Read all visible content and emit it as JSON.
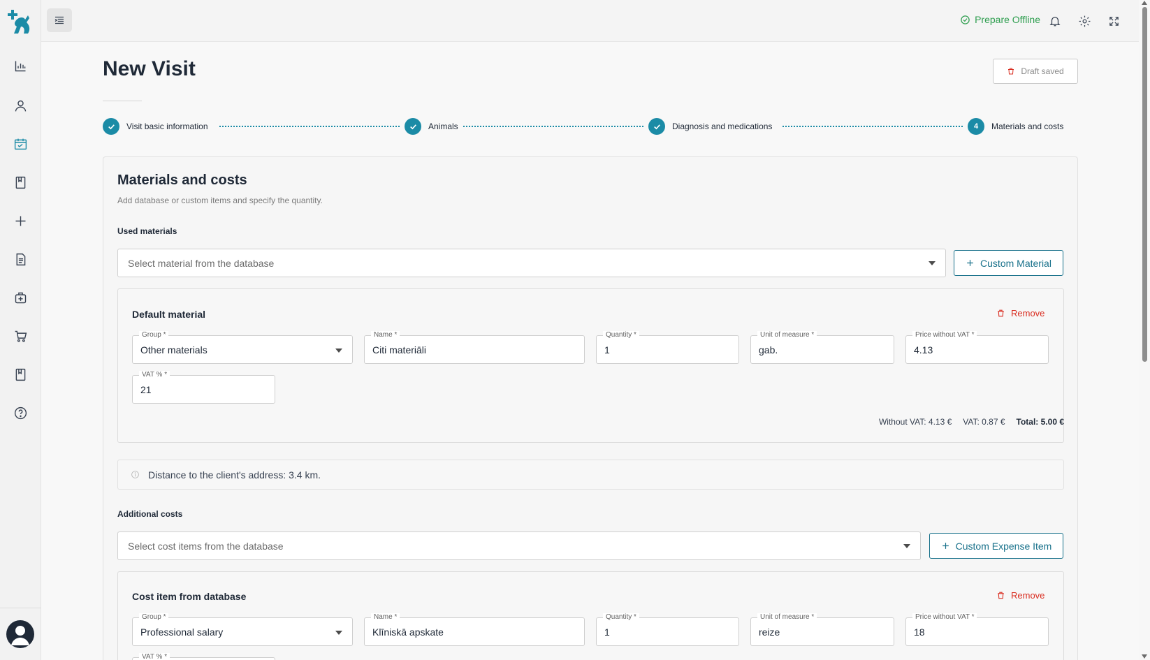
{
  "topbar": {
    "prepare_offline": "Prepare Offline"
  },
  "sidebar": {
    "items": [
      {
        "icon": "chart-icon"
      },
      {
        "icon": "user-icon"
      },
      {
        "icon": "calendar-check-icon",
        "active": true
      },
      {
        "icon": "book-icon"
      },
      {
        "icon": "plus-icon"
      },
      {
        "icon": "document-icon"
      },
      {
        "icon": "medical-bag-icon"
      },
      {
        "icon": "cart-icon"
      },
      {
        "icon": "bookmark-book-icon"
      },
      {
        "icon": "help-icon"
      }
    ]
  },
  "page": {
    "title": "New Visit",
    "draft_label": "Draft saved"
  },
  "stepper": {
    "steps": [
      {
        "label": "Visit basic information",
        "state": "done"
      },
      {
        "label": "Animals",
        "state": "done"
      },
      {
        "label": "Diagnosis and medications",
        "state": "done"
      },
      {
        "label": "Materials and costs",
        "state": "current",
        "number": "4"
      }
    ]
  },
  "card": {
    "title": "Materials and costs",
    "subtitle": "Add database or custom items and specify the quantity.",
    "used_materials": {
      "label": "Used materials",
      "select_placeholder": "Select material from the database",
      "custom_button": "Custom Material",
      "item": {
        "title": "Default material",
        "remove": "Remove",
        "group_label": "Group *",
        "group_value": "Other materials",
        "name_label": "Name *",
        "name_value": "Citi materiāli",
        "quantity_label": "Quantity *",
        "quantity_value": "1",
        "unit_label": "Unit of measure *",
        "unit_value": "gab.",
        "price_label": "Price without VAT *",
        "price_value": "4.13",
        "vat_label": "VAT % *",
        "vat_value": "21",
        "without_vat": "Without VAT: 4.13 €",
        "vat": "VAT: 0.87 €",
        "total": "Total: 5.00 €"
      }
    },
    "distance": "Distance to the client's address: 3.4 km.",
    "additional_costs": {
      "label": "Additional costs",
      "select_placeholder": "Select cost items from the database",
      "custom_button": "Custom Expense Item",
      "item": {
        "title": "Cost item from database",
        "remove": "Remove",
        "group_label": "Group *",
        "group_value": "Professional salary",
        "name_label": "Name *",
        "name_value": "Klīniskā apskate",
        "quantity_label": "Quantity *",
        "quantity_value": "1",
        "unit_label": "Unit of measure *",
        "unit_value": "reize",
        "price_label": "Price without VAT *",
        "price_value": "18",
        "vat_label": "VAT % *"
      }
    }
  },
  "colors": {
    "accent": "#1b8ba6",
    "button_border": "#17708a",
    "success": "#2e9e4f",
    "danger": "#d92d20"
  }
}
